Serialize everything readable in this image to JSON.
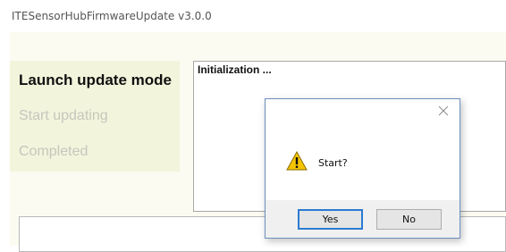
{
  "window": {
    "title": "ITESensorHubFirmwareUpdate v3.0.0"
  },
  "steps": [
    {
      "label": "Launch update mode",
      "state": "active"
    },
    {
      "label": "Start updating",
      "state": "pending"
    },
    {
      "label": "Completed",
      "state": "pending"
    }
  ],
  "log": {
    "text": "Initialization ..."
  },
  "dialog": {
    "message": "Start?",
    "icon": "warning-icon",
    "close_icon": "close-icon",
    "yes_label": "Yes",
    "no_label": "No"
  },
  "colors": {
    "client_bg": "#fbfbf1",
    "steps_panel_bg": "#f3f4dc",
    "step_inactive": "#c6c6bd",
    "default_button_border": "#2b7bd1",
    "warning_fill": "#f4c400"
  }
}
